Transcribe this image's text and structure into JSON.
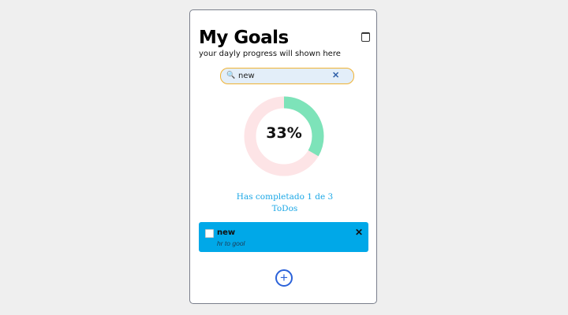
{
  "header": {
    "title": "My Goals",
    "subtitle": "your dayly progress will shown here",
    "calendar_icon": "calendar-icon"
  },
  "search": {
    "value": "new",
    "search_icon": "search-icon",
    "clear_icon": "close-icon"
  },
  "progress": {
    "percent_label": "33%",
    "completed": 1,
    "total": 3,
    "fraction": 0.333,
    "colors": {
      "done": "#7de3b9",
      "remaining": "#fde4e6"
    }
  },
  "summary": {
    "line1": "Has completado 1 de 3",
    "line2": "ToDos"
  },
  "todos": [
    {
      "title": "new",
      "description": "hr to gool",
      "completed": false
    }
  ],
  "add_icon": "plus-circle-icon"
}
